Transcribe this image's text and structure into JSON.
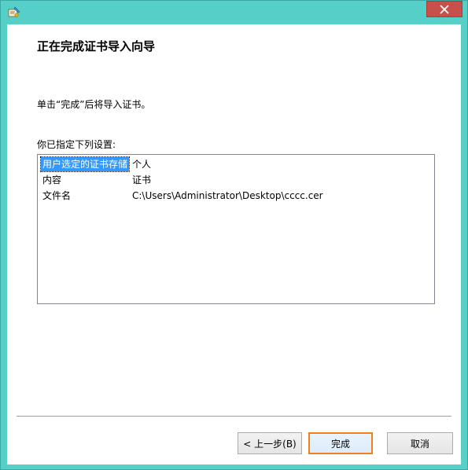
{
  "window": {
    "close_glyph": "✕",
    "app_icon": "certificate-wizard-icon",
    "close_icon": "close-icon"
  },
  "wizard": {
    "heading": "正在完成证书导入向导",
    "instruction": "单击“完成”后将导入证书。",
    "settings_label": "你已指定下列设置:",
    "settings": [
      {
        "key": "用户选定的证书存储",
        "value": "个人"
      },
      {
        "key": "内容",
        "value": "证书"
      },
      {
        "key": "文件名",
        "value": "C:\\Users\\Administrator\\Desktop\\cccc.cer"
      }
    ]
  },
  "buttons": {
    "back": "< 上一步(B)",
    "finish": "完成",
    "cancel": "取消"
  },
  "colors": {
    "frame": "#57cfc9",
    "close_button": "#c7504b",
    "selection": "#3399ff",
    "focus_border": "#f07f1e"
  }
}
